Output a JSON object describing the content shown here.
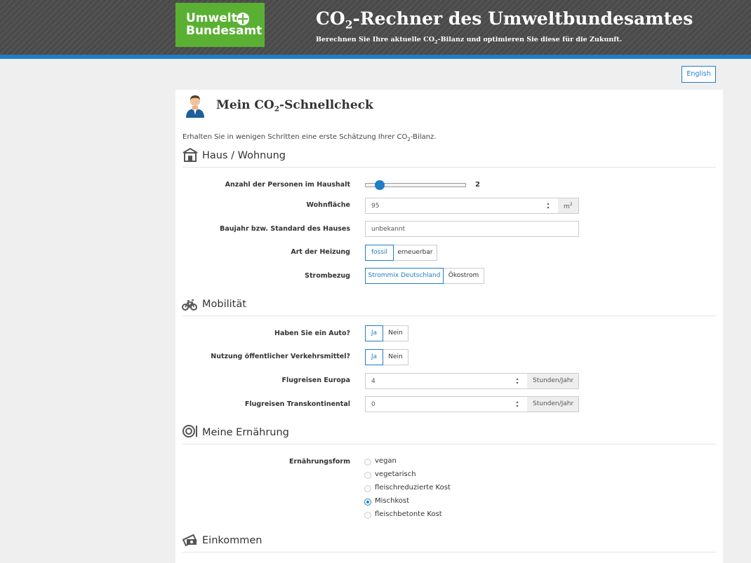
{
  "header": {
    "logo": {
      "line1": "Umwelt",
      "line2": "Bundesamt"
    },
    "title_main": "CO",
    "title_sub": "2",
    "title_rest": "-Rechner des Umweltbundesamtes",
    "subtitle_pre": "Berechnen Sie Ihre aktuelle CO",
    "subtitle_sub": "2",
    "subtitle_post": "-Bilanz und optimieren Sie diese für die Zukunft.",
    "accent_color": "#1f7ec5",
    "logo_color": "#5ab033"
  },
  "language_button": "English",
  "check": {
    "title_pre": "Mein CO",
    "title_sub": "2",
    "title_post": "-Schnellcheck",
    "intro_pre": "Erhalten Sie in wenigen Schritten eine erste Schätzung Ihrer CO",
    "intro_sub": "2",
    "intro_post": "-Bilanz."
  },
  "sections": {
    "house": {
      "title": "Haus / Wohnung",
      "icon": "house-icon",
      "persons": {
        "label": "Anzahl der Personen im Haushalt",
        "value": "2",
        "fraction": 0.11
      },
      "area": {
        "label": "Wohnfläche",
        "value": "95",
        "unit": "m",
        "unit_sup": "2"
      },
      "year": {
        "label": "Baujahr bzw. Standard des Hauses",
        "value": "unbekannt"
      },
      "heating": {
        "label": "Art der Heizung",
        "options": [
          "fossil",
          "erneuerbar"
        ],
        "selected": "fossil"
      },
      "power": {
        "label": "Strombezug",
        "options": [
          "Strommix Deutschland",
          "Ökostrom"
        ],
        "selected": "Strommix Deutschland"
      }
    },
    "mobility": {
      "title": "Mobilität",
      "icon": "bicycle-icon",
      "car": {
        "label": "Haben Sie ein Auto?",
        "options": [
          "Ja",
          "Nein"
        ],
        "selected": "Ja"
      },
      "public": {
        "label": "Nutzung öffentlicher Verkehrsmittel?",
        "options": [
          "Ja",
          "Nein"
        ],
        "selected": "Ja"
      },
      "flights_eu": {
        "label": "Flugreisen Europa",
        "value": "4",
        "unit": "Stunden/Jahr"
      },
      "flights_trans": {
        "label": "Flugreisen Transkontinental",
        "value": "0",
        "unit": "Stunden/Jahr"
      }
    },
    "food": {
      "title": "Meine Ernährung",
      "icon": "plate-icon",
      "label": "Ernährungsform",
      "options": [
        "vegan",
        "vegetarisch",
        "fleischreduzierte Kost",
        "Mischkost",
        "fleischbetonte Kost"
      ],
      "selected": "Mischkost"
    },
    "income": {
      "title": "Einkommen",
      "icon": "money-icon"
    }
  }
}
